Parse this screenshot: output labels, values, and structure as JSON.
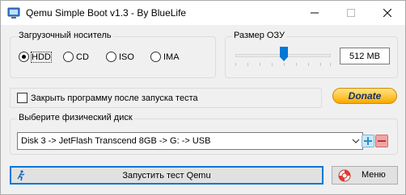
{
  "window": {
    "title": "Qemu Simple Boot v1.3 - By BlueLife"
  },
  "boot_media": {
    "label": "Загрузочный носитель",
    "options": [
      "HDD",
      "CD",
      "ISO",
      "IMA"
    ],
    "selected": "HDD"
  },
  "ram": {
    "label": "Размер ОЗУ",
    "value": "512 MB",
    "slider_fraction": 0.5
  },
  "close_after": {
    "label": "Закрыть программу после запуска теста",
    "checked": false
  },
  "donate": {
    "label": "Donate"
  },
  "disk": {
    "label": "Выберите физический диск",
    "selected": "Disk 3 -> JetFlash Transcend 8GB -> G: -> USB"
  },
  "actions": {
    "start_label": "Запустить тест Qemu",
    "menu_label": "Меню"
  },
  "colors": {
    "accent": "#0078d7",
    "donate_gold": "#ffc53a",
    "minus_red": "#e57373",
    "plus_blue": "#cde8f5"
  }
}
